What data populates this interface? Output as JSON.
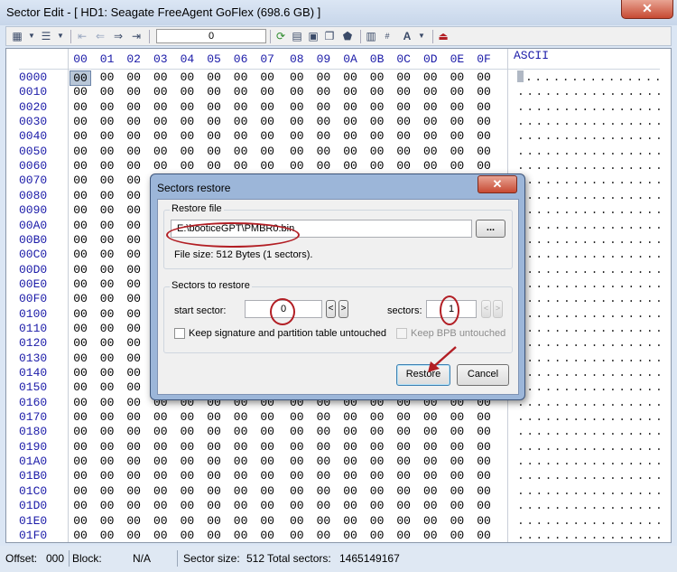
{
  "window": {
    "title": "Sector Edit - [ HD1: Seagate FreeAgent GoFlex (698.6 GB) ]",
    "close_glyph": "✕"
  },
  "toolbar": {
    "sector_value": "0",
    "icons": [
      "view-mode-icon",
      "column-mode-icon",
      "first-sector-icon",
      "prev-sector-icon",
      "next-sector-icon",
      "last-sector-icon",
      "refresh-icon",
      "save-icon",
      "save-as-icon",
      "copy-icon",
      "restore-icon",
      "calculator-icon",
      "hex-calc-icon",
      "font-icon",
      "exit-icon"
    ]
  },
  "editor": {
    "header_bytes": [
      "00",
      "01",
      "02",
      "03",
      "04",
      "05",
      "06",
      "07",
      "08",
      "09",
      "0A",
      "0B",
      "0C",
      "0D",
      "0E",
      "0F"
    ],
    "ascii_header": "ASCII",
    "addresses": [
      "0000",
      "0010",
      "0020",
      "0030",
      "0040",
      "0050",
      "0060",
      "0070",
      "0080",
      "0090",
      "00A0",
      "00B0",
      "00C0",
      "00D0",
      "00E0",
      "00F0",
      "0100",
      "0110",
      "0120",
      "0130",
      "0140",
      "0150",
      "0160",
      "0170",
      "0180",
      "0190",
      "01A0",
      "01B0",
      "01C0",
      "01D0",
      "01E0",
      "01F0"
    ],
    "byte_value": "00",
    "ascii_dots": "................"
  },
  "status": {
    "offset_label": "Offset:",
    "offset_value": "000",
    "block_label": "Block:",
    "block_value": "N/A",
    "sector_size_label": "Sector size:",
    "sector_size_value": "512",
    "total_sectors_label": "Total sectors:",
    "total_sectors_value": "1465149167"
  },
  "dialog": {
    "title": "Sectors restore",
    "close_glyph": "✕",
    "restore_file_group": "Restore file",
    "file_path": "E:\\booticeGPT\\PMBR0.bin",
    "browse_label": "...",
    "file_size_text": "File size: 512 Bytes (1 sectors).",
    "sectors_group": "Sectors to restore",
    "start_sector_label": "start sector:",
    "start_sector_value": "0",
    "prev_label": "<",
    "next_label": ">",
    "sectors_label": "sectors:",
    "sectors_value": "1",
    "keep_signature_label": "Keep signature and partition table untouched",
    "keep_bpb_label": "Keep BPB untouched",
    "restore_button": "Restore",
    "cancel_button": "Cancel"
  },
  "colors": {
    "annotation_red": "#b21e24",
    "hex_blue": "#1b1ba8"
  }
}
